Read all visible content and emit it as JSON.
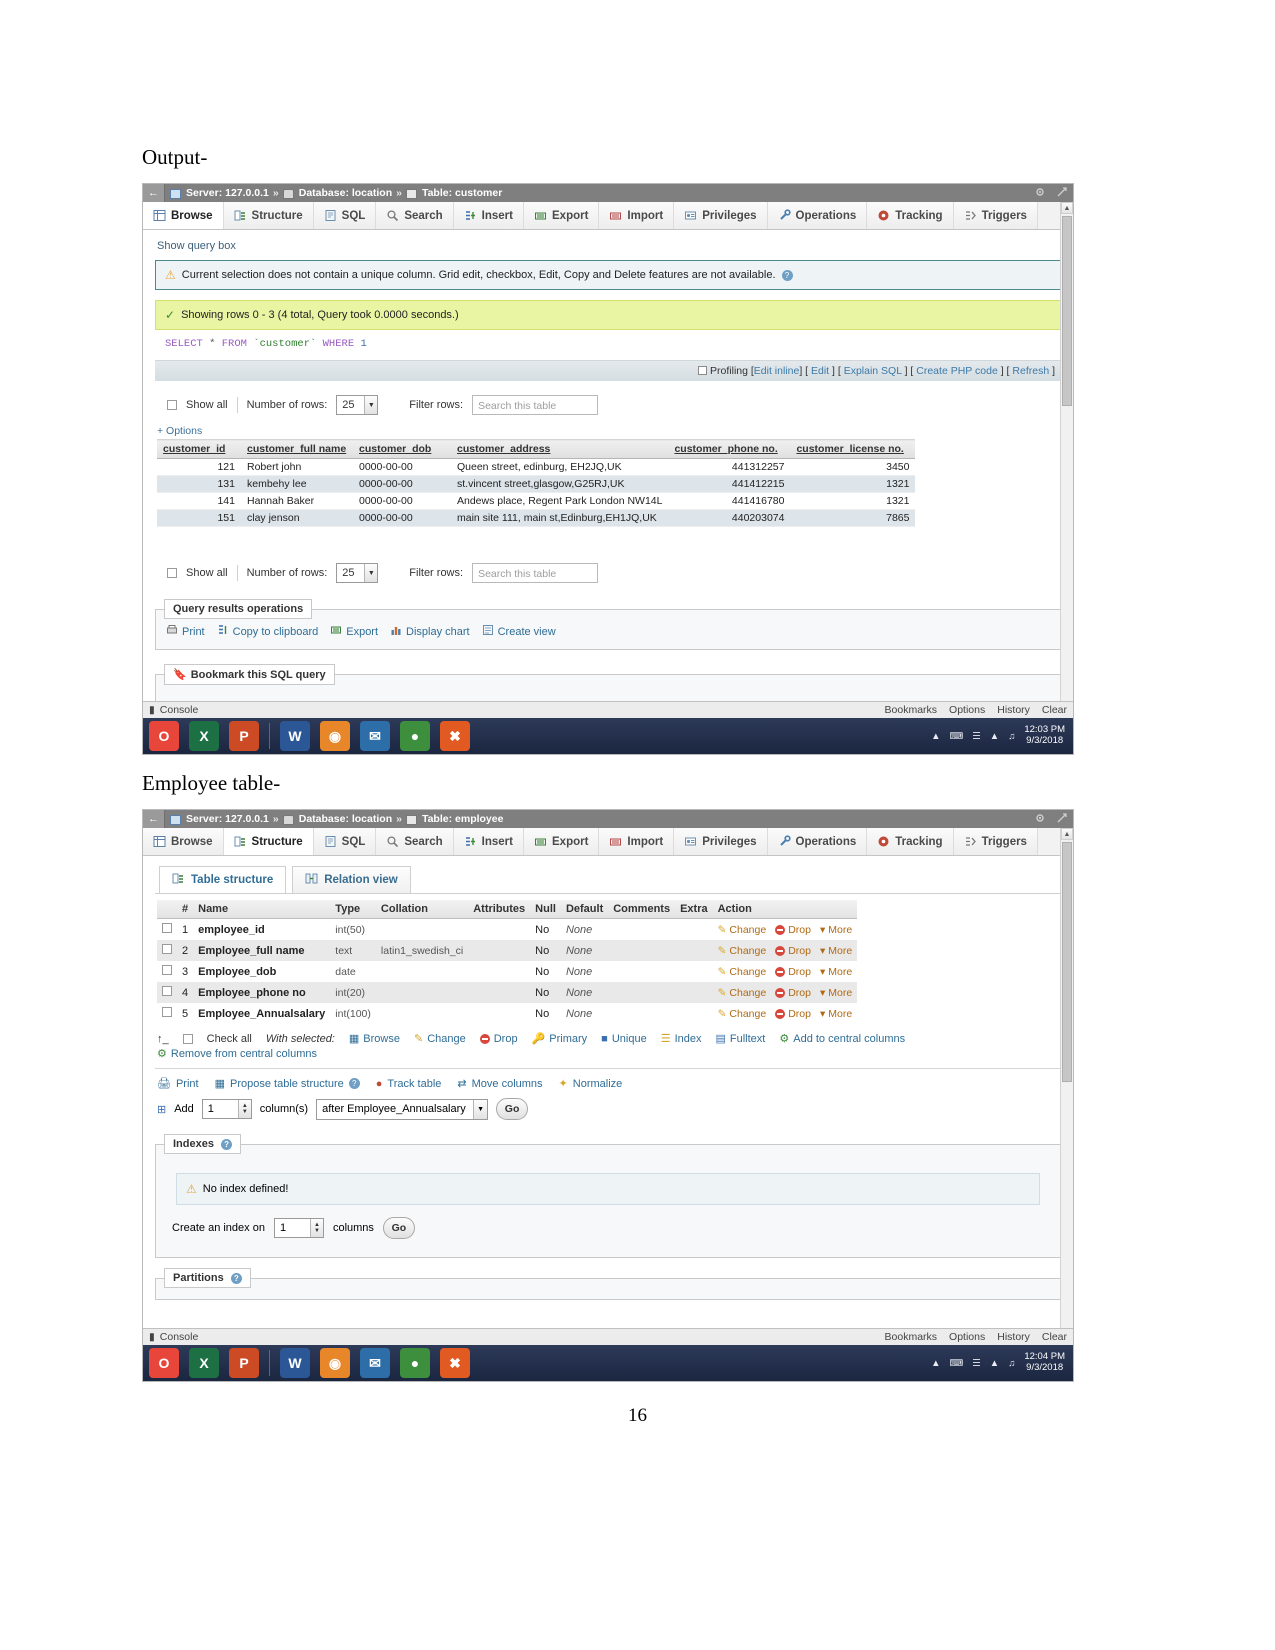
{
  "document": {
    "caption1": "Output-",
    "caption2": "Employee table-",
    "page_number": "16"
  },
  "shot1": {
    "titlebar": {
      "back": "←",
      "server": "Server: 127.0.0.1",
      "database": "Database: location",
      "table": "Table: customer",
      "sep": "»"
    },
    "tabs": [
      {
        "label": "Browse",
        "icon": "grid-icon"
      },
      {
        "label": "Structure",
        "icon": "structure-icon"
      },
      {
        "label": "SQL",
        "icon": "sql-icon"
      },
      {
        "label": "Search",
        "icon": "search-icon"
      },
      {
        "label": "Insert",
        "icon": "insert-icon"
      },
      {
        "label": "Export",
        "icon": "export-icon"
      },
      {
        "label": "Import",
        "icon": "import-icon"
      },
      {
        "label": "Privileges",
        "icon": "privileges-icon"
      },
      {
        "label": "Operations",
        "icon": "operations-icon"
      },
      {
        "label": "Tracking",
        "icon": "tracking-icon"
      },
      {
        "label": "Triggers",
        "icon": "triggers-icon"
      }
    ],
    "show_query_box": "Show query box",
    "notice": "Current selection does not contain a unique column. Grid edit, checkbox, Edit, Copy and Delete features are not available.",
    "success": "Showing rows 0 - 3 (4 total, Query took 0.0000 seconds.)",
    "sql": {
      "kw1": "SELECT",
      "star": "*",
      "kw2": "FROM",
      "ident": "`customer`",
      "kw3": "WHERE",
      "num": "1"
    },
    "profiling": {
      "label": "Profiling",
      "links": [
        "Edit inline",
        "Edit",
        "Explain SQL",
        "Create PHP code",
        "Refresh"
      ]
    },
    "rowsbar": {
      "show_all": "Show all",
      "number_of_rows_label": "Number of rows:",
      "number_of_rows_value": "25",
      "filter_rows_label": "Filter rows:",
      "filter_placeholder": "Search this table"
    },
    "options_link": "+ Options",
    "table": {
      "columns": [
        "customer_id",
        "customer_full name",
        "customer_dob",
        "customer_address",
        "customer_phone no.",
        "customer_license no."
      ],
      "rows": [
        [
          "121",
          "Robert john",
          "0000-00-00",
          "Queen street, edinburg, EH2JQ,UK",
          "441312257",
          "3450"
        ],
        [
          "131",
          "kembehy lee",
          "0000-00-00",
          "st.vincent street,glasgow,G25RJ,UK",
          "441412215",
          "1321"
        ],
        [
          "141",
          "Hannah Baker",
          "0000-00-00",
          "Andews place, Regent Park London NW14L",
          "441416780",
          "1321"
        ],
        [
          "151",
          "clay jenson",
          "0000-00-00",
          "main site 111, main st,Edinburg,EH1JQ,UK",
          "440203074",
          "7865"
        ]
      ]
    },
    "query_results_operations": {
      "legend": "Query results operations",
      "items": [
        {
          "label": "Print",
          "icon": "printer-icon"
        },
        {
          "label": "Copy to clipboard",
          "icon": "clipboard-icon"
        },
        {
          "label": "Export",
          "icon": "export-icon"
        },
        {
          "label": "Display chart",
          "icon": "chart-icon"
        },
        {
          "label": "Create view",
          "icon": "view-icon"
        }
      ]
    },
    "bookmark": {
      "legend": "Bookmark this SQL query",
      "icon": "bookmark-icon"
    },
    "console": {
      "label": "Console",
      "right": [
        "Bookmarks",
        "Options",
        "History",
        "Clear"
      ]
    },
    "taskbar": {
      "icons": [
        {
          "name": "opera-icon",
          "glyph": "O",
          "bg": "#e8463a"
        },
        {
          "name": "excel-icon",
          "glyph": "X",
          "bg": "#1d7044"
        },
        {
          "name": "powerpoint-icon",
          "glyph": "P",
          "bg": "#cc4b25"
        },
        {
          "name": "word-icon",
          "glyph": "W",
          "bg": "#2b5797"
        },
        {
          "name": "firefox-icon",
          "glyph": "◉",
          "bg": "#e8862a"
        },
        {
          "name": "thunderbird-icon",
          "glyph": "✉",
          "bg": "#2d6ea8"
        },
        {
          "name": "chrome-icon",
          "glyph": "●",
          "bg": "#3d8f3d"
        },
        {
          "name": "xampp-icon",
          "glyph": "✖",
          "bg": "#e05a22"
        }
      ],
      "tray": [
        "▴",
        "⌨",
        "⚡",
        "📶",
        "🔊"
      ],
      "time": "12:03 PM",
      "date": "9/3/2018"
    }
  },
  "shot2": {
    "titlebar": {
      "back": "←",
      "server": "Server: 127.0.0.1",
      "database": "Database: location",
      "table": "Table: employee",
      "sep": "»"
    },
    "tabs": [
      {
        "label": "Browse",
        "icon": "grid-icon"
      },
      {
        "label": "Structure",
        "icon": "structure-icon"
      },
      {
        "label": "SQL",
        "icon": "sql-icon"
      },
      {
        "label": "Search",
        "icon": "search-icon"
      },
      {
        "label": "Insert",
        "icon": "insert-icon"
      },
      {
        "label": "Export",
        "icon": "export-icon"
      },
      {
        "label": "Import",
        "icon": "import-icon"
      },
      {
        "label": "Privileges",
        "icon": "privileges-icon"
      },
      {
        "label": "Operations",
        "icon": "operations-icon"
      },
      {
        "label": "Tracking",
        "icon": "tracking-icon"
      },
      {
        "label": "Triggers",
        "icon": "triggers-icon"
      }
    ],
    "subtabs": [
      {
        "label": "Table structure",
        "icon": "structure-icon"
      },
      {
        "label": "Relation view",
        "icon": "relation-icon"
      }
    ],
    "structure_table": {
      "columns": [
        "#",
        "Name",
        "Type",
        "Collation",
        "Attributes",
        "Null",
        "Default",
        "Comments",
        "Extra",
        "Action"
      ],
      "rows": [
        {
          "num": "1",
          "name": "employee_id",
          "type": "int(50)",
          "collation": "",
          "attributes": "",
          "null": "No",
          "default": "None",
          "comments": "",
          "extra": ""
        },
        {
          "num": "2",
          "name": "Employee_full name",
          "type": "text",
          "collation": "latin1_swedish_ci",
          "attributes": "",
          "null": "No",
          "default": "None",
          "comments": "",
          "extra": ""
        },
        {
          "num": "3",
          "name": "Employee_dob",
          "type": "date",
          "collation": "",
          "attributes": "",
          "null": "No",
          "default": "None",
          "comments": "",
          "extra": ""
        },
        {
          "num": "4",
          "name": "Employee_phone no",
          "type": "int(20)",
          "collation": "",
          "attributes": "",
          "null": "No",
          "default": "None",
          "comments": "",
          "extra": ""
        },
        {
          "num": "5",
          "name": "Employee_Annualsalary",
          "type": "int(100)",
          "collation": "",
          "attributes": "",
          "null": "No",
          "default": "None",
          "comments": "",
          "extra": ""
        }
      ],
      "actions": [
        "Change",
        "Drop",
        "More"
      ]
    },
    "withselected": {
      "check_all": "Check all",
      "label": "With selected:",
      "items": [
        "Browse",
        "Change",
        "Drop",
        "Primary",
        "Unique",
        "Index",
        "Fulltext",
        "Add to central columns"
      ],
      "remove": "Remove from central columns"
    },
    "toolrow": [
      "Print",
      "Propose table structure",
      "Track table",
      "Move columns",
      "Normalize"
    ],
    "addrow": {
      "add": "Add",
      "count": "1",
      "columns_label": "column(s)",
      "position": "after Employee_Annualsalary",
      "go": "Go"
    },
    "indexes": {
      "legend": "Indexes",
      "notice": "No index defined!",
      "create_label": "Create an index on",
      "create_value": "1",
      "columns_label": "columns",
      "go": "Go"
    },
    "partitions": {
      "legend": "Partitions"
    },
    "console": {
      "label": "Console",
      "right": [
        "Bookmarks",
        "Options",
        "History",
        "Clear"
      ]
    },
    "taskbar": {
      "icons": [
        {
          "name": "opera-icon",
          "glyph": "O",
          "bg": "#e8463a"
        },
        {
          "name": "excel-icon",
          "glyph": "X",
          "bg": "#1d7044"
        },
        {
          "name": "powerpoint-icon",
          "glyph": "P",
          "bg": "#cc4b25"
        },
        {
          "name": "word-icon",
          "glyph": "W",
          "bg": "#2b5797"
        },
        {
          "name": "firefox-icon",
          "glyph": "◉",
          "bg": "#e8862a"
        },
        {
          "name": "thunderbird-icon",
          "glyph": "✉",
          "bg": "#2d6ea8"
        },
        {
          "name": "chrome-icon",
          "glyph": "●",
          "bg": "#3d8f3d"
        },
        {
          "name": "xampp-icon",
          "glyph": "✖",
          "bg": "#e05a22"
        }
      ],
      "time": "12:04 PM",
      "date": "9/3/2018"
    }
  }
}
